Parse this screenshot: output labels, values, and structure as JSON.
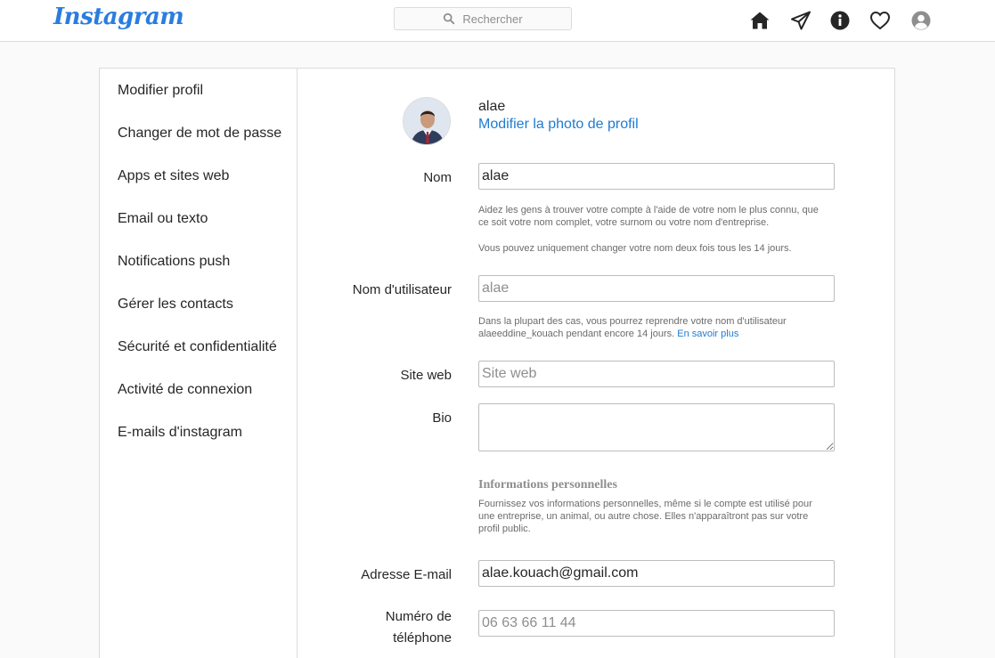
{
  "header": {
    "logo": "Instagram",
    "search_placeholder": "Rechercher",
    "icons": [
      "home-icon",
      "direct-send-icon",
      "info-icon",
      "heart-icon",
      "profile-icon"
    ]
  },
  "sidebar": {
    "items": [
      {
        "label": "Modifier profil"
      },
      {
        "label": "Changer de mot de passe"
      },
      {
        "label": "Apps et sites web"
      },
      {
        "label": "Email ou texto"
      },
      {
        "label": "Notifications push"
      },
      {
        "label": "Gérer les contacts"
      },
      {
        "label": "Sécurité et confidentialité"
      },
      {
        "label": "Activité de connexion"
      },
      {
        "label": "E-mails d'instagram"
      }
    ]
  },
  "profile": {
    "username": "alae",
    "change_photo": "Modifier la photo de profil"
  },
  "form": {
    "name": {
      "label": "Nom",
      "value": "alae",
      "help1": "Aidez les gens à trouver votre compte à l'aide de votre nom le plus connu, que ce soit votre nom complet, votre surnom ou votre nom d'entreprise.",
      "help2": "Vous pouvez uniquement changer votre nom deux fois tous les 14 jours."
    },
    "username": {
      "label": "Nom d'utilisateur",
      "placeholder": "alae",
      "help": "Dans la plupart des cas, vous pourrez reprendre votre nom d'utilisateur alaeeddine_kouach pendant encore 14 jours.",
      "help_link": "En savoir plus"
    },
    "website": {
      "label": "Site web",
      "placeholder": "Site web"
    },
    "bio": {
      "label": "Bio",
      "value": ""
    },
    "personal": {
      "title": "Informations personnelles",
      "text": "Fournissez vos informations personnelles, même si le compte est utilisé pour une entreprise, un animal, ou autre chose. Elles n'apparaîtront pas sur votre profil public."
    },
    "email": {
      "label": "Adresse E-mail",
      "value": "alae.kouach@gmail.com"
    },
    "phone": {
      "label_line1": "Numéro de",
      "label_line2": "téléphone",
      "placeholder": "06 63 66 11 44"
    }
  },
  "colors": {
    "accent": "#1f7bd0",
    "logo": "#2a7dde",
    "border": "#dbdbdb",
    "background": "#fafafa"
  }
}
